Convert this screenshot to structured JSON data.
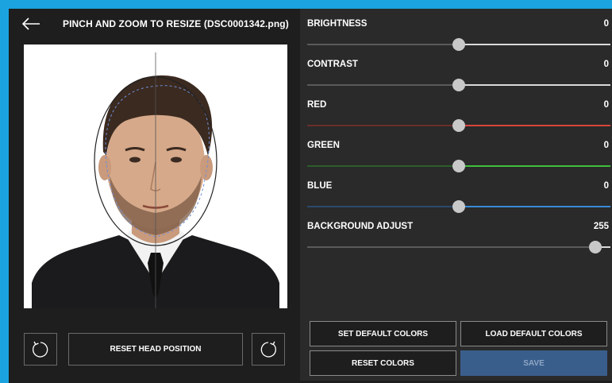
{
  "header": {
    "title": "PINCH AND ZOOM TO RESIZE (DSC0001342.png)"
  },
  "left_buttons": {
    "reset_head": "RESET HEAD POSITION"
  },
  "sliders": [
    {
      "label": "BRIGHTNESS",
      "value": "0",
      "fraction": 0.5,
      "color": "#d9d9d9",
      "dim": "#5a5a5a"
    },
    {
      "label": "CONTRAST",
      "value": "0",
      "fraction": 0.5,
      "color": "#d9d9d9",
      "dim": "#5a5a5a"
    },
    {
      "label": "RED",
      "value": "0",
      "fraction": 0.5,
      "color": "#d8453a",
      "dim": "#6b2f2b"
    },
    {
      "label": "GREEN",
      "value": "0",
      "fraction": 0.5,
      "color": "#3fbe3a",
      "dim": "#2c5e2b"
    },
    {
      "label": "BLUE",
      "value": "0",
      "fraction": 0.5,
      "color": "#3a8ad8",
      "dim": "#2c4a6b"
    },
    {
      "label": "BACKGROUND ADJUST",
      "value": "255",
      "fraction": 0.95,
      "color": "#d9d9d9",
      "dim": "#5a5a5a"
    }
  ],
  "bottom_buttons": {
    "set_default": "SET DEFAULT COLORS",
    "load_default": "LOAD DEFAULT COLORS",
    "reset_colors": "RESET COLORS",
    "save": "SAVE"
  },
  "colors": {
    "frame": "#1aa3df",
    "save_bg": "#3a5e8c"
  },
  "icons": {
    "back": "back-arrow-icon",
    "rotate_left": "rotate-ccw-icon",
    "rotate_right": "rotate-cw-icon"
  }
}
